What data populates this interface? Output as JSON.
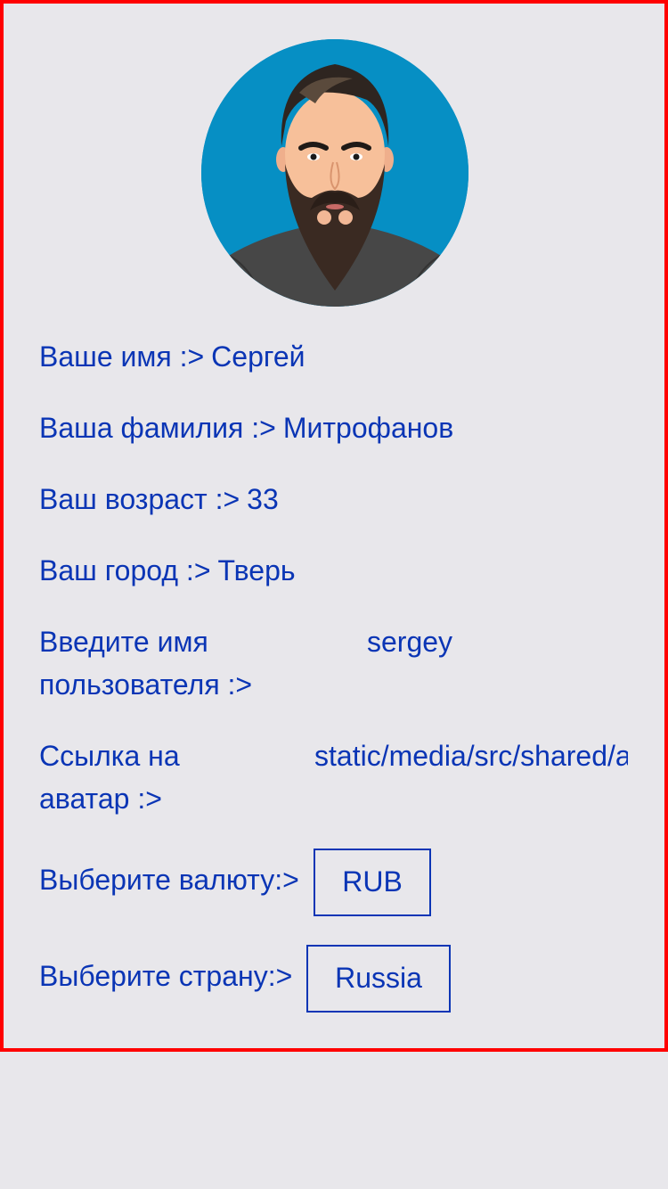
{
  "profile": {
    "name_label": "Ваше имя :>",
    "name_value": "Сергей",
    "surname_label": "Ваша фамилия :>",
    "surname_value": "Митрофанов",
    "age_label": "Ваш возраст :>",
    "age_value": "33",
    "city_label": "Ваш город :>",
    "city_value": "Тверь",
    "username_label": "Введите имя пользователя :>",
    "username_value": "sergey",
    "avatar_link_label": "Ссылка на аватар :>",
    "avatar_link_value": "static/media/src/shared/a",
    "currency_label": "Выберите валюту:>",
    "currency_value": "RUB",
    "country_label": "Выберите страну:>",
    "country_value": "Russia"
  },
  "colors": {
    "text": "#0a35b5",
    "frame_border": "#ff0000",
    "background": "#e8e7eb",
    "avatar_bg": "#068fc4"
  }
}
